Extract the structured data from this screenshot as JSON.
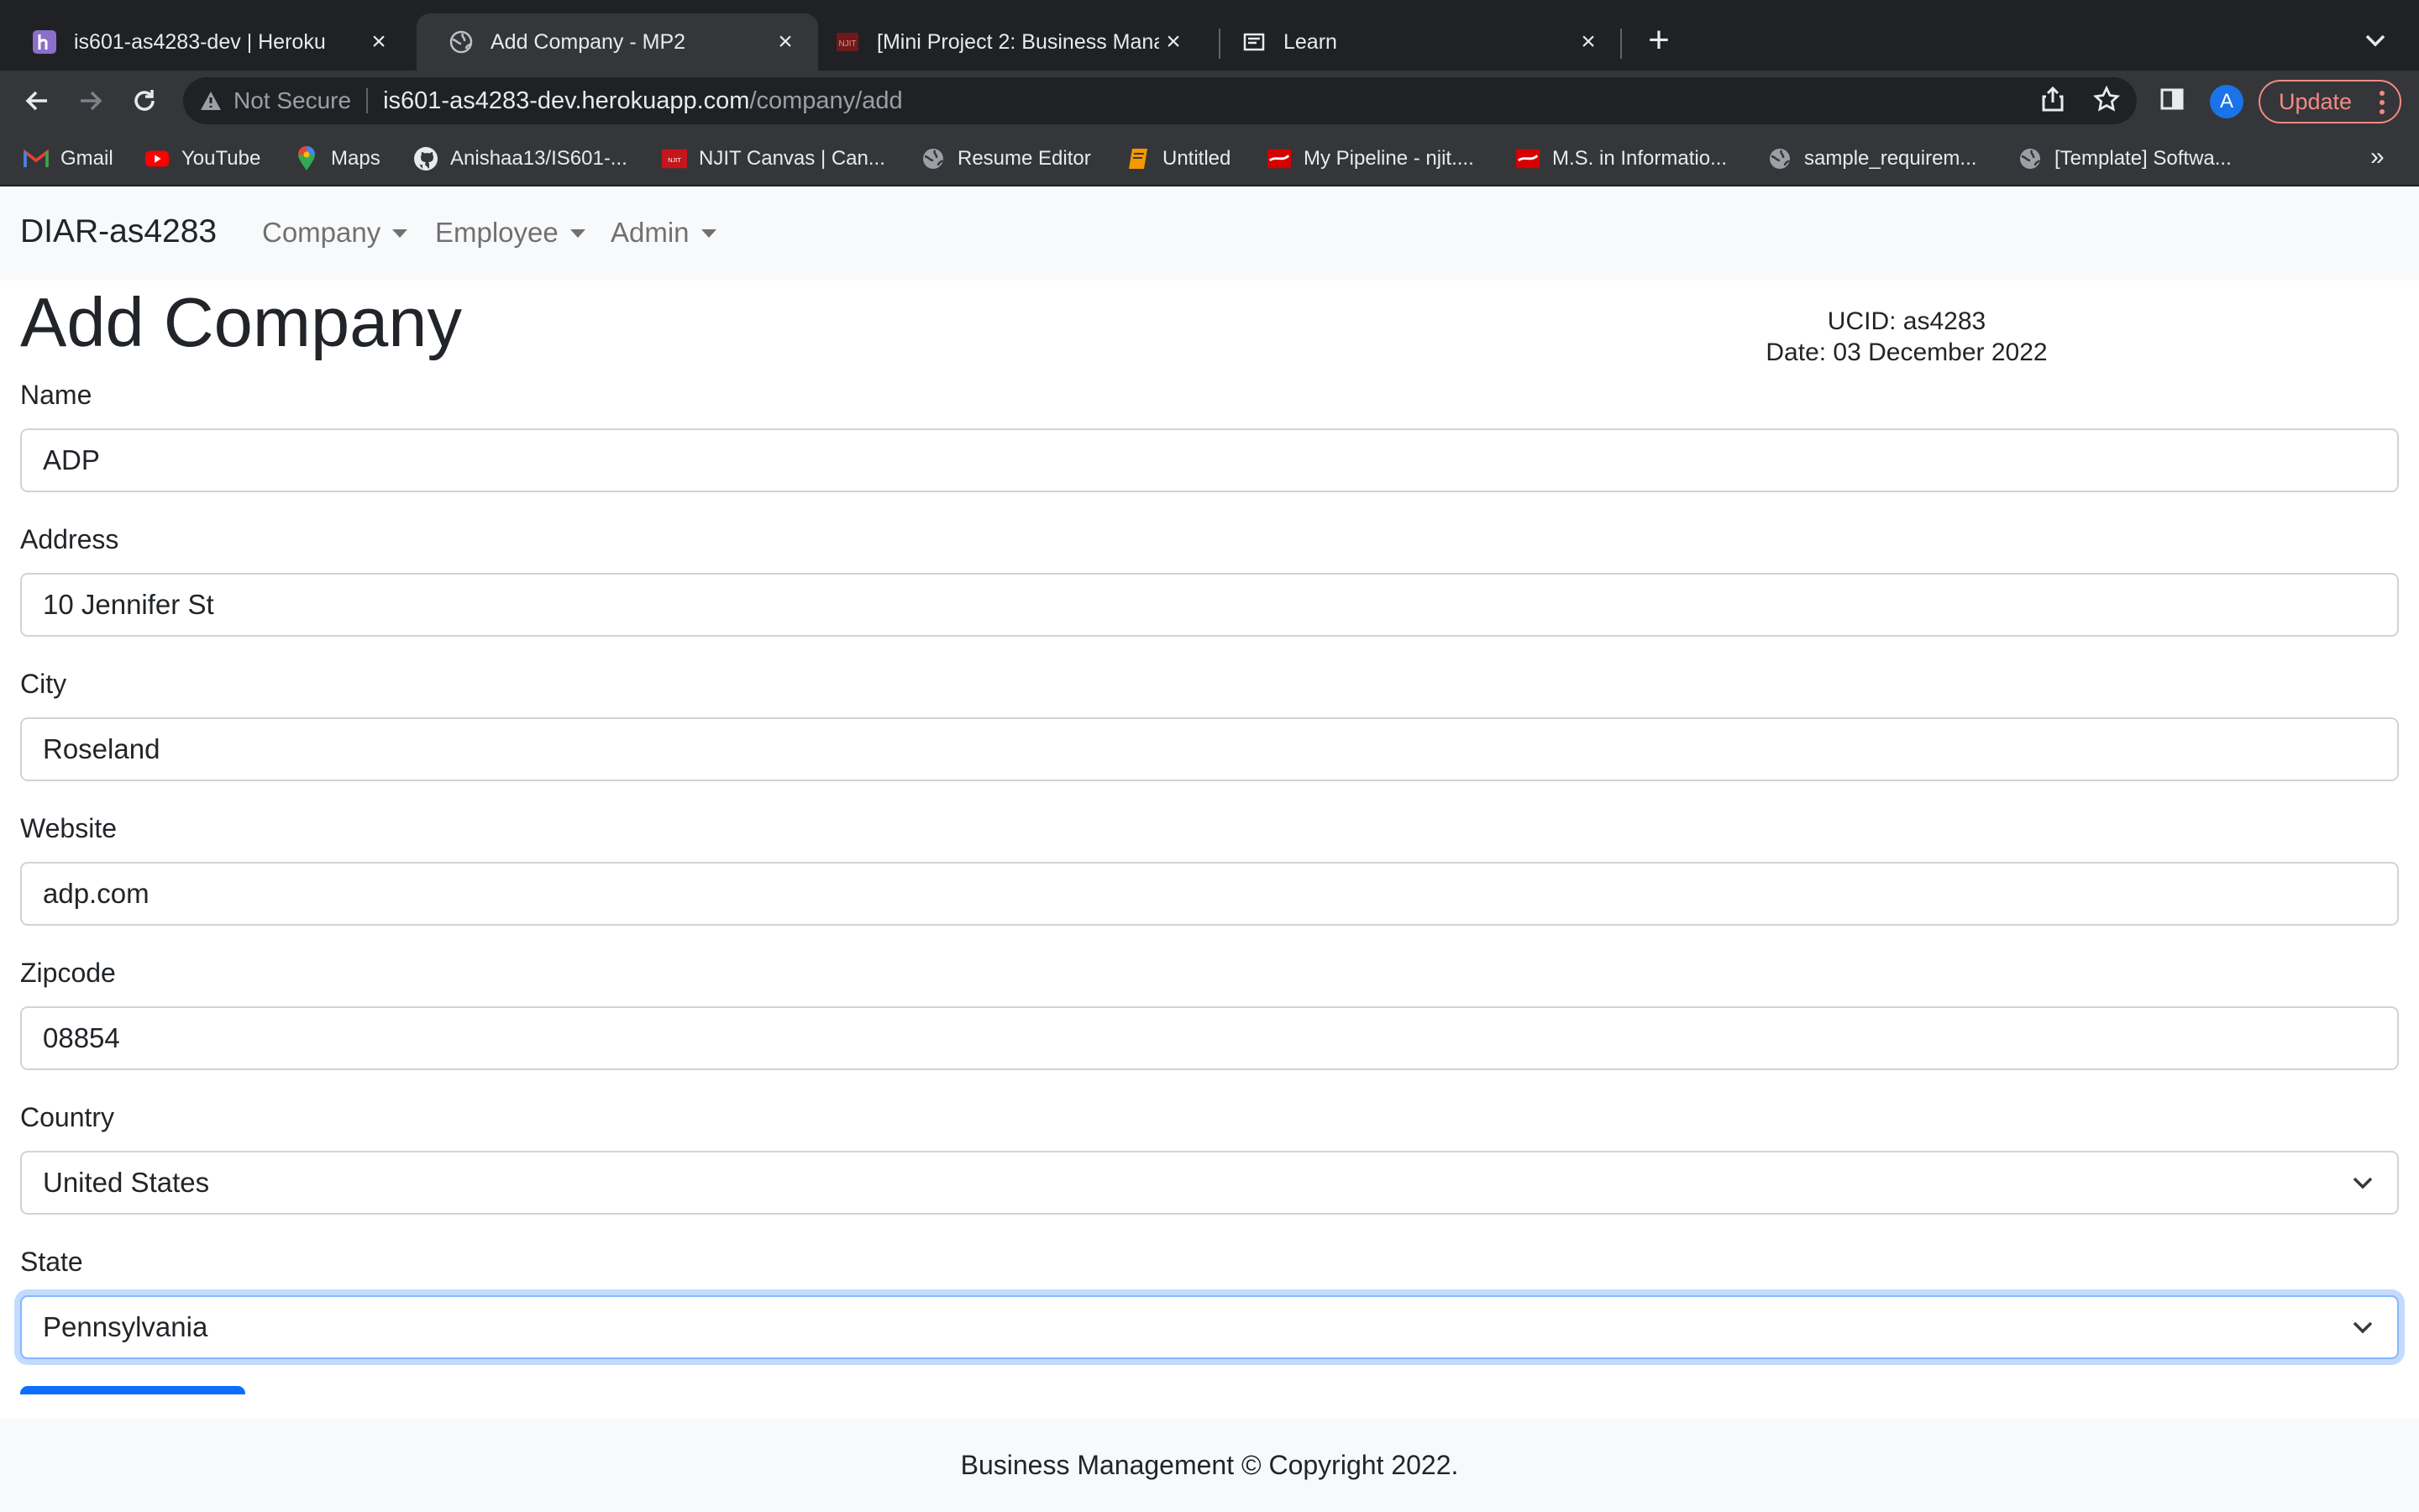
{
  "browser": {
    "tabs": [
      {
        "title": "is601-as4283-dev | Heroku",
        "icon": "heroku-icon",
        "active": false
      },
      {
        "title": "Add Company - MP2",
        "icon": "globe-icon",
        "active": true
      },
      {
        "title": "[Mini Project 2: Business Mana",
        "icon": "njit-icon",
        "active": false
      },
      {
        "title": "Learn",
        "icon": "learn-icon",
        "active": false
      }
    ],
    "address": {
      "security_label": "Not Secure",
      "host": "is601-as4283-dev.herokuapp.com",
      "path": "/company/add"
    },
    "profile_initial": "A",
    "update_label": "Update",
    "bookmarks": [
      {
        "label": "Gmail",
        "icon": "gmail-icon"
      },
      {
        "label": "YouTube",
        "icon": "youtube-icon"
      },
      {
        "label": "Maps",
        "icon": "maps-icon"
      },
      {
        "label": "Anishaa13/IS601-...",
        "icon": "github-icon"
      },
      {
        "label": "NJIT Canvas | Can...",
        "icon": "njit-icon"
      },
      {
        "label": "Resume Editor",
        "icon": "globe-icon"
      },
      {
        "label": "Untitled",
        "icon": "book-icon"
      },
      {
        "label": "My Pipeline - njit....",
        "icon": "flag-icon"
      },
      {
        "label": "M.S. in Informatio...",
        "icon": "flag-icon"
      },
      {
        "label": "sample_requirem...",
        "icon": "globe-icon"
      },
      {
        "label": "[Template] Softwa...",
        "icon": "globe-icon"
      }
    ],
    "bookmarks_more": "»"
  },
  "navbar": {
    "brand": "DIAR-as4283",
    "menus": [
      "Company",
      "Employee",
      "Admin"
    ]
  },
  "page": {
    "title": "Add Company",
    "ucid": "UCID: as4283",
    "date": "Date: 03 December 2022"
  },
  "form": {
    "fields": [
      {
        "label": "Name",
        "value": "ADP",
        "type": "text"
      },
      {
        "label": "Address",
        "value": "10 Jennifer St",
        "type": "text"
      },
      {
        "label": "City",
        "value": "Roseland",
        "type": "text"
      },
      {
        "label": "Website",
        "value": "adp.com",
        "type": "text"
      },
      {
        "label": "Zipcode",
        "value": "08854",
        "type": "text"
      },
      {
        "label": "Country",
        "value": "United States",
        "type": "select"
      },
      {
        "label": "State",
        "value": "Pennsylvania",
        "type": "select",
        "focused": true
      }
    ]
  },
  "footer": {
    "text": "Business Management © Copyright 2022."
  },
  "colors": {
    "primary": "#0d6efd",
    "chrome_dark": "#202124",
    "chrome_toolbar": "#35363a",
    "navbar_bg": "#f8f9fa",
    "update_accent": "#f28b82",
    "avatar_blue": "#1a73e8"
  }
}
